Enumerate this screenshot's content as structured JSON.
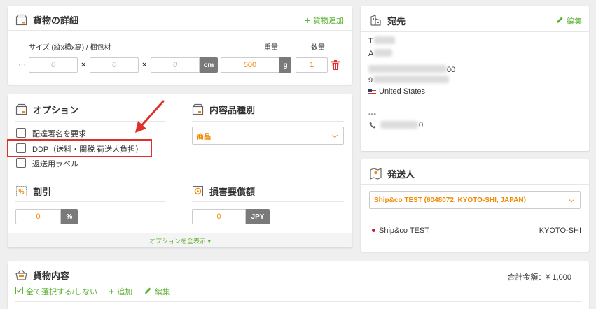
{
  "cargo": {
    "title": "貨物の詳細",
    "add_label": "貨物追加",
    "size_label": "サイズ (縦x横x高) / 梱包材",
    "weight_label": "重量",
    "qty_label": "数量",
    "dim_placeholder": "0",
    "dim_unit": "cm",
    "weight_value": "500",
    "weight_unit": "g",
    "qty_value": "1",
    "times": "×",
    "dots": "⋯"
  },
  "options": {
    "title": "オプション",
    "items": [
      {
        "label": "配達署名を要求"
      },
      {
        "label": "DDP（送料・関税 荷送人負担）"
      },
      {
        "label": "返送用ラベル"
      }
    ],
    "discount_title": "割引",
    "discount_value": "0",
    "discount_unit": "%",
    "insurance_title": "損害要償額",
    "insurance_value": "0",
    "insurance_unit": "JPY",
    "show_all": "オプションを全表示 ▾"
  },
  "content_type": {
    "title": "内容品種別",
    "selected": "商品"
  },
  "destination": {
    "title": "宛先",
    "edit_label": "編集",
    "line1": "T",
    "line2": "A",
    "line3": "00",
    "line4": "9",
    "country": "United States",
    "dashes": "---",
    "phone_suffix": "0"
  },
  "sender": {
    "title": "発送人",
    "selected": "Ship&co TEST (6048072, KYOTO-SHI, JAPAN)",
    "name": "Ship&co TEST",
    "city": "KYOTO-SHI"
  },
  "contents": {
    "title": "貨物内容",
    "total_label": "合計金額：¥ 1,000",
    "select_all": "全て選択する/しない",
    "add_label": "追加",
    "edit_label": "編集"
  }
}
